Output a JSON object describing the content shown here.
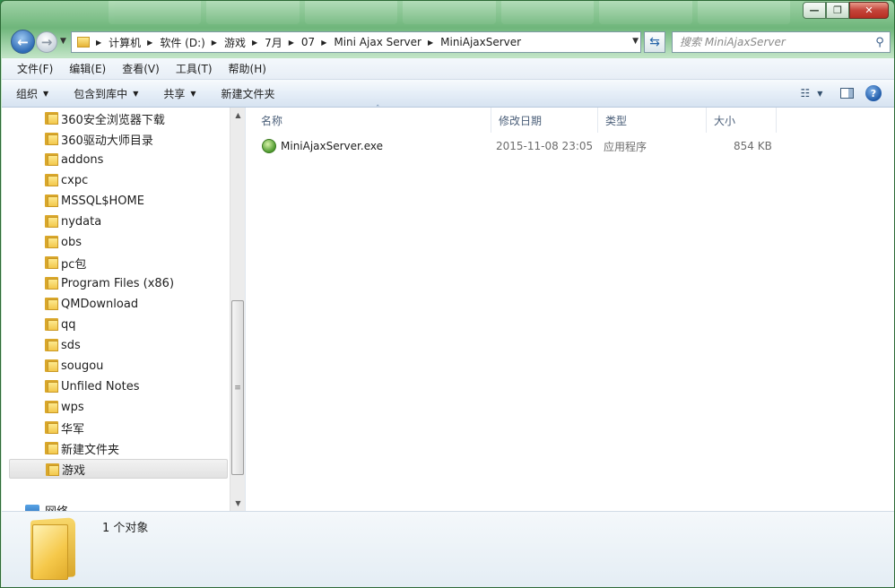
{
  "window": {
    "controls": {
      "minimize": "—",
      "maximize": "❐",
      "close": "✕"
    }
  },
  "nav": {
    "back_icon": "arrow-left-icon",
    "forward_icon": "arrow-right-icon",
    "breadcrumbs": [
      "计算机",
      "软件 (D:)",
      "游戏",
      "7月",
      "07",
      "Mini Ajax Server",
      "MiniAjaxServer"
    ],
    "search_placeholder": "搜索 MiniAjaxServer"
  },
  "menu": [
    "文件(F)",
    "编辑(E)",
    "查看(V)",
    "工具(T)",
    "帮助(H)"
  ],
  "commands": [
    {
      "label": "组织",
      "dropdown": true
    },
    {
      "label": "包含到库中",
      "dropdown": true
    },
    {
      "label": "共享",
      "dropdown": true
    },
    {
      "label": "新建文件夹",
      "dropdown": false
    }
  ],
  "tree": {
    "items": [
      "360安全浏览器下载",
      "360驱动大师目录",
      "addons",
      "cxpc",
      "MSSQL$HOME",
      "nydata",
      "obs",
      "pc包",
      "Program Files (x86)",
      "QMDownload",
      "qq",
      "sds",
      "sougou",
      "Unfiled Notes",
      "wps",
      "华军",
      "新建文件夹",
      "游戏"
    ],
    "selected": "游戏",
    "network_label": "网络"
  },
  "columns": {
    "name": "名称",
    "modified": "修改日期",
    "type": "类型",
    "size": "大小"
  },
  "files": [
    {
      "name": "MiniAjaxServer.exe",
      "modified": "2015-11-08 23:05",
      "type": "应用程序",
      "size": "854 KB"
    }
  ],
  "status": {
    "count_text": "1 个对象"
  },
  "colors": {
    "frame": "#6fb67b",
    "selection": "#e6e6e6",
    "accent": "#2f6cb6"
  }
}
